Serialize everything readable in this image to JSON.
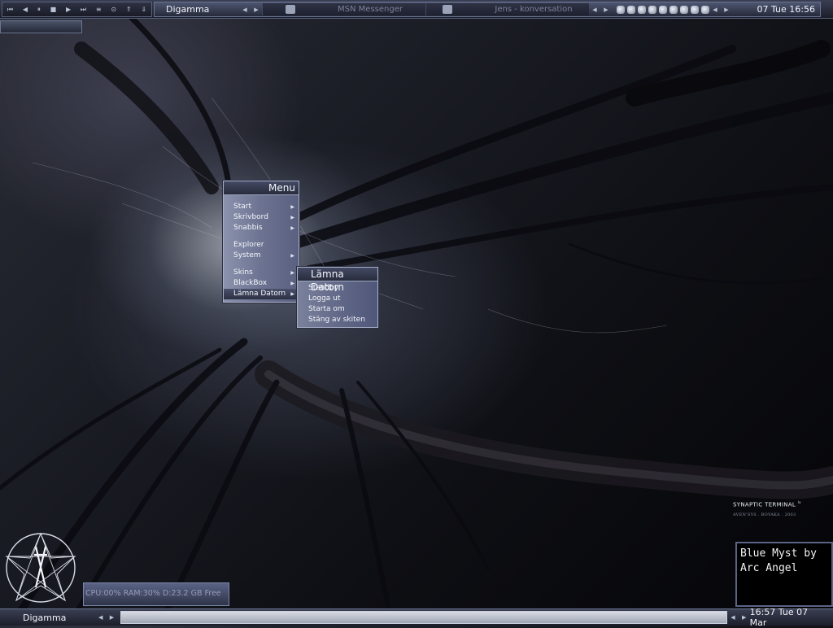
{
  "topbar": {
    "media_controls": [
      "⏮",
      "◀",
      "⏸",
      "■",
      "▶",
      "⏭",
      "≡",
      "⊙",
      "⇑",
      "⇓"
    ],
    "workspace": "Digamma",
    "tasks": [
      {
        "label": "MSN Messenger",
        "icon": "msn-icon"
      },
      {
        "label": "Jens - konversation",
        "icon": "chat-icon"
      }
    ],
    "tray_icons": [
      "network-icon",
      "people-icon",
      "tools-icon",
      "display-icon",
      "hourglass-icon",
      "lightning-icon",
      "key-icon",
      "cursor-icon",
      "speaker-icon"
    ],
    "clock": "07 Tue 16:56"
  },
  "main_menu": {
    "title": "Menu",
    "groups": [
      [
        {
          "label": "Start",
          "submenu": true
        },
        {
          "label": "Skrivbord",
          "submenu": true
        },
        {
          "label": "Snabbis",
          "submenu": true
        }
      ],
      [
        {
          "label": "Explorer",
          "submenu": false
        },
        {
          "label": "System",
          "submenu": true
        }
      ],
      [
        {
          "label": "Skins",
          "submenu": true
        },
        {
          "label": "BlackBox",
          "submenu": true
        },
        {
          "label": "Lämna Datorn",
          "submenu": true
        }
      ]
    ]
  },
  "leave_menu": {
    "title": "Lämna Datorn",
    "items": [
      "Standby",
      "Logga ut",
      "Starta om",
      "Stäng av skiten"
    ]
  },
  "synaptic": {
    "title": "SYNAPTIC TERMINAL",
    "sup": "lv",
    "credit": "AVEN'SYS . BOYAKA . 2003"
  },
  "infobox": {
    "text": "Blue Myst by\nArc Angel"
  },
  "sysmon": {
    "text": "CPU:00% RAM:30% D:23.2 GB Free"
  },
  "bottombar": {
    "workspace": "Digamma",
    "clock": "16:57 Tue 07 Mar"
  }
}
